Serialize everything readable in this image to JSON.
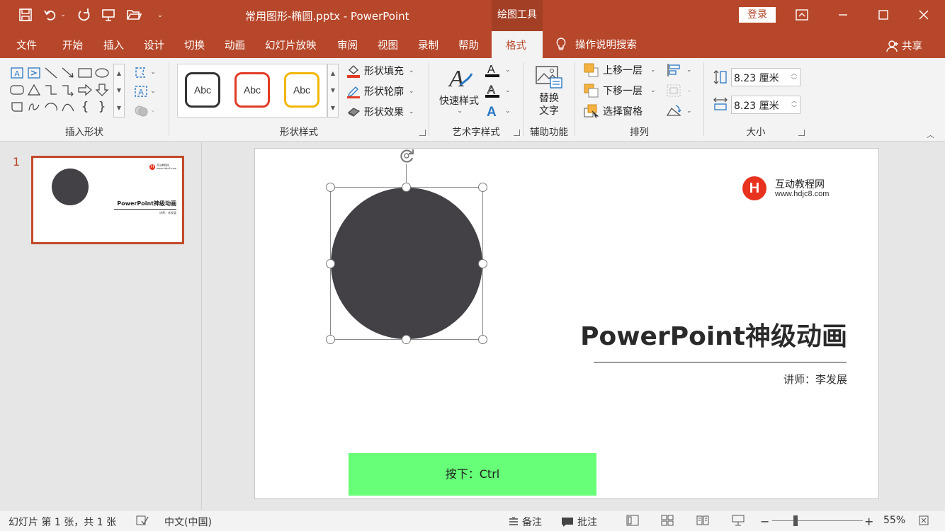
{
  "title_bar": {
    "doc_title": "常用图形-椭圆.pptx  -  PowerPoint",
    "context_tab": "绘图工具",
    "login": "登录"
  },
  "tabs": [
    "文件",
    "开始",
    "插入",
    "设计",
    "切换",
    "动画",
    "幻灯片放映",
    "审阅",
    "视图",
    "录制",
    "帮助",
    "格式"
  ],
  "active_tab": "格式",
  "tell_me": "操作说明搜索",
  "share": "共享",
  "ribbon": {
    "insert_shapes": {
      "label": "插入形状"
    },
    "shape_styles": {
      "label": "形状样式",
      "swatch_text": "Abc",
      "swatch_colors": [
        "#333333",
        "#e23b25",
        "#f2b600"
      ],
      "fill": "形状填充",
      "outline": "形状轮廓",
      "effect": "形状效果"
    },
    "wordart": {
      "label": "艺术字样式",
      "quick_styles": "快速样式"
    },
    "accessibility": {
      "label": "辅助功能",
      "alt_text_1": "替换",
      "alt_text_2": "文字"
    },
    "arrange": {
      "label": "排列",
      "bring_forward": "上移一层",
      "send_backward": "下移一层",
      "selection_pane": "选择窗格"
    },
    "size": {
      "label": "大小",
      "height": "8.23 厘米",
      "width": "8.23 厘米"
    }
  },
  "thumbnail": {
    "number": "1",
    "title": "PowerPoint神级动画",
    "subtitle": "讲师：李发展",
    "logo_name": "互动教程网",
    "logo_url": "www.hdjc8.com"
  },
  "slide": {
    "logo_letter": "H",
    "logo_name": "互动教程网",
    "logo_url": "www.hdjc8.com",
    "title": "PowerPoint神级动画",
    "subtitle": "讲师：李发展",
    "key_hint": "按下：Ctrl",
    "circle_color": "#434146",
    "key_hint_color": "#66ff77"
  },
  "status_bar": {
    "slide_info": "幻灯片 第 1 张，共 1 张",
    "language": "中文(中国)",
    "notes": "备注",
    "comments": "批注",
    "zoom": "55%",
    "zoom_level": 0.55
  }
}
